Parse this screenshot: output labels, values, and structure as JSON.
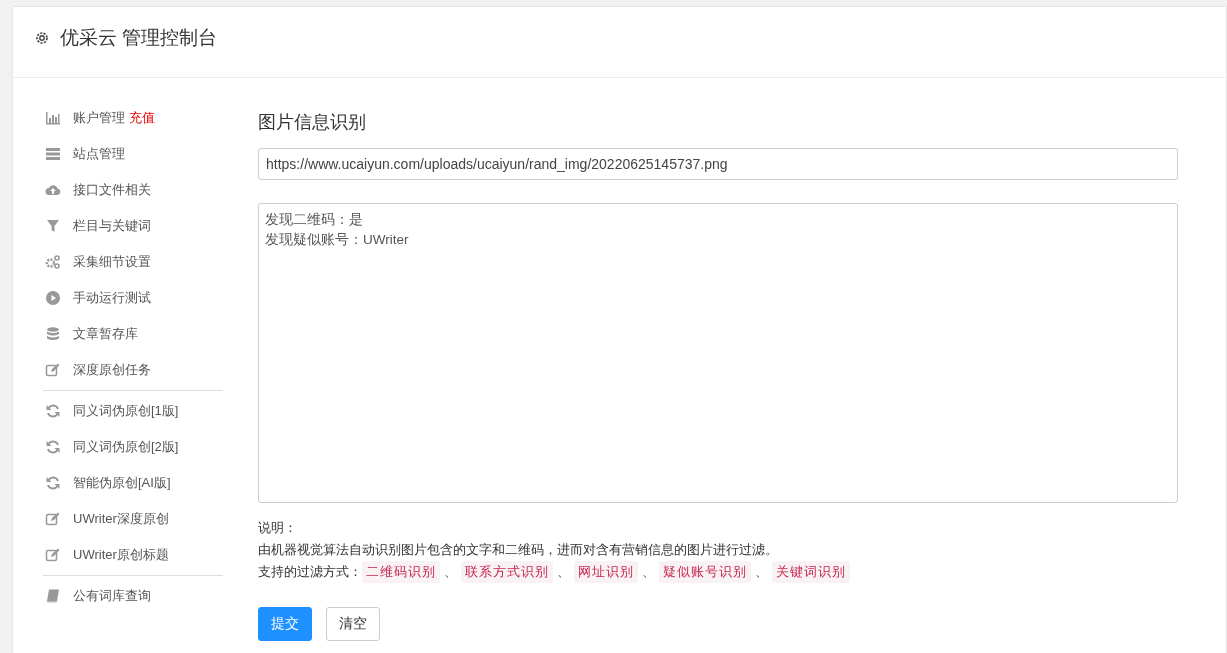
{
  "header": {
    "title": "优采云 管理控制台"
  },
  "sidebar": {
    "groups": [
      [
        {
          "label": "账户管理",
          "badge": "充值"
        },
        {
          "label": "站点管理"
        },
        {
          "label": "接口文件相关"
        },
        {
          "label": "栏目与关键词"
        },
        {
          "label": "采集细节设置"
        },
        {
          "label": "手动运行测试"
        },
        {
          "label": "文章暂存库"
        },
        {
          "label": "深度原创任务"
        }
      ],
      [
        {
          "label": "同义词伪原创[1版]"
        },
        {
          "label": "同义词伪原创[2版]"
        },
        {
          "label": "智能伪原创[AI版]"
        },
        {
          "label": "UWriter深度原创"
        },
        {
          "label": "UWriter原创标题"
        }
      ],
      [
        {
          "label": "公有词库查询"
        }
      ]
    ]
  },
  "main": {
    "title": "图片信息识别",
    "url_field": {
      "value": "https://www.ucaiyun.com/uploads/ucaiyun/rand_img/20220625145737.png"
    },
    "result_field": {
      "lines": [
        "发现二维码：是",
        "发现疑似账号：UWriter"
      ]
    },
    "notes": {
      "heading": "说明：",
      "description": "由机器视觉算法自动识别图片包含的文字和二维码，进而对含有营销信息的图片进行过滤。",
      "methods_label": "支持的过滤方式：",
      "separator": "、",
      "methods": [
        "二维码识别",
        "联系方式识别",
        "网址识别",
        "疑似账号识别",
        "关键词识别"
      ]
    },
    "buttons": [
      {
        "label": "提交",
        "kind": "primary"
      },
      {
        "label": "清空",
        "kind": "default"
      }
    ]
  }
}
